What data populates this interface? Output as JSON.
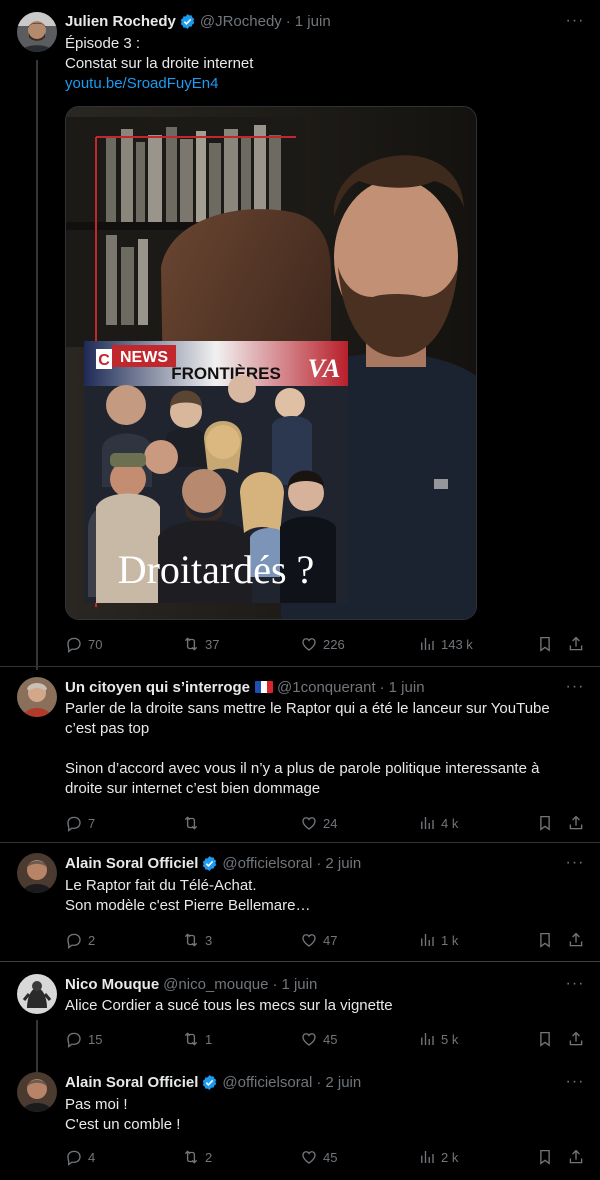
{
  "tweets": [
    {
      "name": "Julien Rochedy",
      "handle": "@JRochedy",
      "date": "1 juin",
      "lines": [
        "Épisode 3 :",
        "Constat sur la droite internet"
      ],
      "link": "youtu.be/SroadFuyEn4",
      "thumbnail": {
        "brand_c": "C",
        "brand_news": "NEWS",
        "brand_frontieres": "FRONTIÈRES",
        "brand_va": "VA",
        "title": "Droitardés ?"
      },
      "stats": {
        "replies": "70",
        "retweets": "37",
        "likes": "226",
        "views": "143 k"
      }
    },
    {
      "name": "Un citoyen qui s’interroge",
      "handle": "@1conquerant",
      "date": "1 juin",
      "lines": [
        "Parler de la droite sans mettre le Raptor qui a été le lanceur sur YouTube",
        "c’est pas top",
        "",
        "Sinon d’accord avec vous il n’y a plus de parole politique interessante à",
        "droite sur internet c’est bien dommage"
      ],
      "stats": {
        "replies": "7",
        "retweets": "",
        "likes": "24",
        "views": "4 k"
      }
    },
    {
      "name": "Alain Soral Officiel",
      "handle": "@officielsoral",
      "date": "2 juin",
      "lines": [
        "Le Raptor fait du Télé-Achat.",
        "Son modèle c'est Pierre Bellemare…"
      ],
      "stats": {
        "replies": "2",
        "retweets": "3",
        "likes": "47",
        "views": "1 k"
      }
    },
    {
      "name": "Nico Mouque",
      "handle": "@nico_mouque",
      "date": "1 juin",
      "lines": [
        "Alice Cordier a sucé tous les mecs sur la vignette"
      ],
      "stats": {
        "replies": "15",
        "retweets": "1",
        "likes": "45",
        "views": "5 k"
      }
    },
    {
      "name": "Alain Soral Officiel",
      "handle": "@officielsoral",
      "date": "2 juin",
      "lines": [
        "Pas moi !",
        "C'est un comble !"
      ],
      "stats": {
        "replies": "4",
        "retweets": "2",
        "likes": "45",
        "views": "2 k"
      }
    }
  ],
  "separator": "·",
  "more_label": "···",
  "colors": {
    "background": "#000000",
    "text": "#e7e9ea",
    "secondary": "#71767b",
    "link": "#1d9bf0",
    "verified": "#1d9bf0",
    "divider": "#2f3336"
  },
  "icons": [
    "verified-badge-icon",
    "more-icon",
    "reply-icon",
    "retweet-icon",
    "like-icon",
    "views-icon",
    "bookmark-icon",
    "share-icon",
    "france-flag-icon"
  ]
}
